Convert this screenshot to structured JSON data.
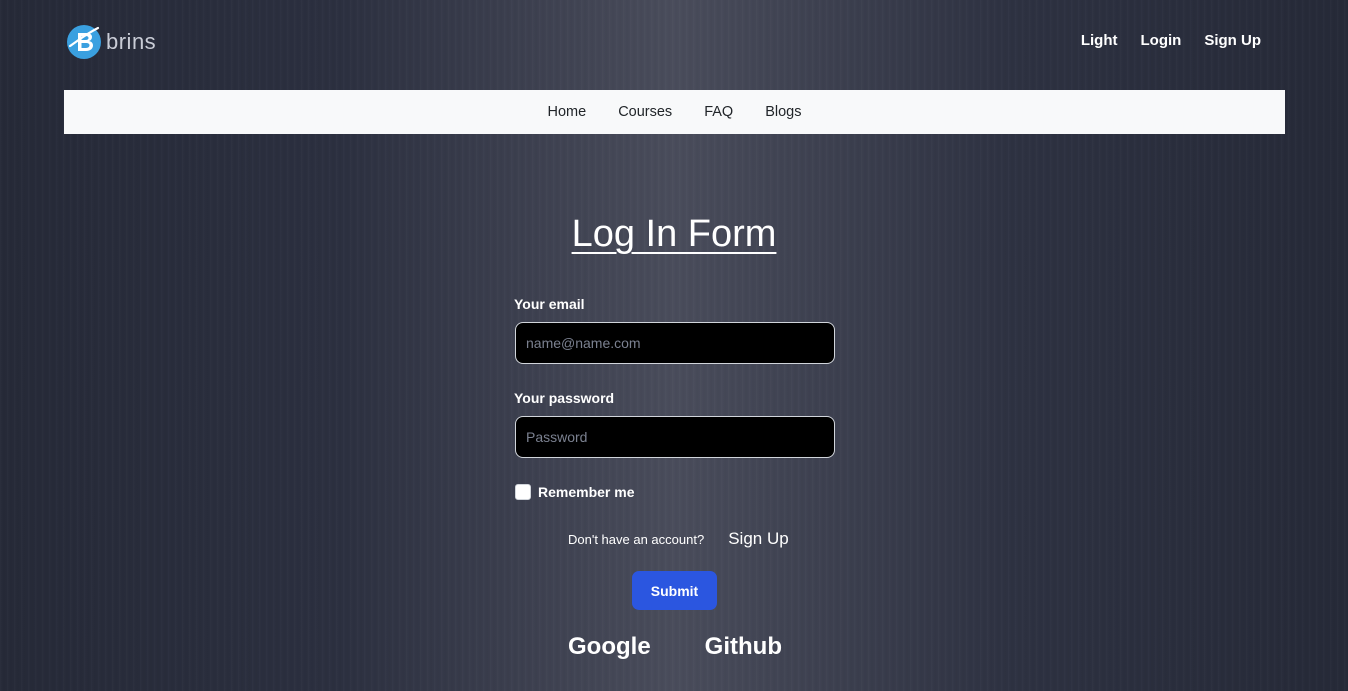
{
  "brand": {
    "name": "brins",
    "logo_icon": "brand-b-logo",
    "accent": "#3aa0e0"
  },
  "top_links": {
    "theme": "Light",
    "login": "Login",
    "signup": "Sign Up"
  },
  "nav": {
    "home": "Home",
    "courses": "Courses",
    "faq": "FAQ",
    "blogs": "Blogs"
  },
  "form": {
    "title": "Log In Form",
    "email_label": "Your email",
    "email_placeholder": "name@name.com",
    "email_value": "",
    "password_label": "Your password",
    "password_placeholder": "Password",
    "password_value": "",
    "remember_label": "Remember me",
    "remember_checked": false,
    "no_account_text": "Don't have an account?",
    "signup_link": "Sign Up",
    "submit_label": "Submit",
    "submit_color": "#2b56e0"
  },
  "social": {
    "google": "Google",
    "github": "Github"
  }
}
